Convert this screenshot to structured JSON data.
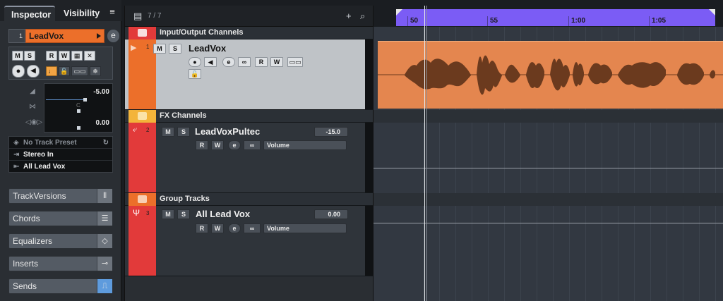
{
  "inspector": {
    "tabs": {
      "inspector": "Inspector",
      "visibility": "Visibility",
      "menu": "≡"
    },
    "track": {
      "number": "1",
      "name": "LeadVox"
    },
    "buttons": {
      "mute": "M",
      "solo": "S",
      "read": "R",
      "write": "W"
    },
    "fader": {
      "volume": "-5.00",
      "pan_center": "C",
      "pan": "0.00"
    },
    "routing": {
      "preset": "No Track Preset",
      "input": "Stereo In",
      "output": "All Lead Vox"
    },
    "sections": [
      {
        "label": "TrackVersions"
      },
      {
        "label": "Chords"
      },
      {
        "label": "Equalizers"
      },
      {
        "label": "Inserts"
      },
      {
        "label": "Sends"
      }
    ]
  },
  "tracklist": {
    "count": "7 / 7",
    "folders": [
      {
        "name": "Input/Output Channels"
      },
      {
        "name": "FX Channels"
      },
      {
        "name": "Group Tracks"
      }
    ],
    "tracks": [
      {
        "number": "1",
        "name": "LeadVox",
        "color": "#ec6f2a"
      },
      {
        "number": "2",
        "name": "LeadVoxPultec",
        "value": "-15.0",
        "param": "Volume",
        "color": "#e23a3a"
      },
      {
        "number": "3",
        "name": "All Lead Vox",
        "value": "0.00",
        "param": "Volume",
        "color": "#e23a3a"
      }
    ],
    "buttons": {
      "mute": "M",
      "solo": "S",
      "read": "R",
      "write": "W"
    }
  },
  "ruler": {
    "labels": [
      "50",
      "55",
      "1:00",
      "1:05"
    ]
  },
  "colors": {
    "audio_event": "#e4864f",
    "cycle": "#7b5cf5",
    "fx_track": "#e23a3a",
    "folder": "#f3b43a"
  }
}
